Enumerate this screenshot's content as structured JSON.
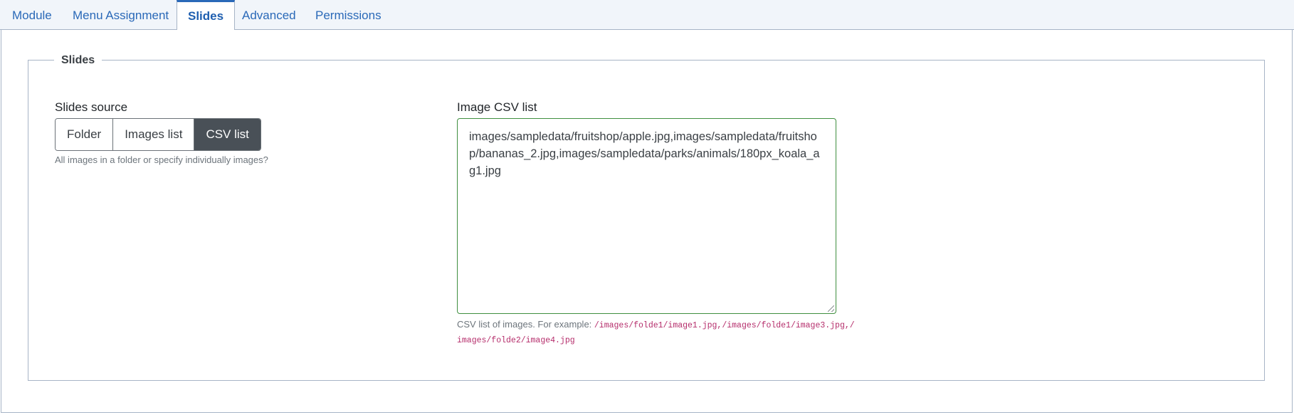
{
  "tabs": [
    {
      "label": "Module",
      "active": false
    },
    {
      "label": "Menu Assignment",
      "active": false
    },
    {
      "label": "Slides",
      "active": true
    },
    {
      "label": "Advanced",
      "active": false
    },
    {
      "label": "Permissions",
      "active": false
    }
  ],
  "fieldset": {
    "legend": "Slides"
  },
  "slides_source": {
    "label": "Slides source",
    "options": [
      "Folder",
      "Images list",
      "CSV list"
    ],
    "selected": "CSV list",
    "help": "All images in a folder or specify individually images?"
  },
  "csv_list": {
    "label": "Image CSV list",
    "value": "images/sampledata/fruitshop/apple.jpg,images/sampledata/fruitshop/bananas_2.jpg,images/sampledata/parks/animals/180px_koala_ag1.jpg",
    "help_prefix": "CSV list of images. For example: ",
    "help_example": "/images/folde1/image1.jpg,/images/folde1/image3.jpg,/images/folde2/image4.jpg"
  },
  "colors": {
    "accent": "#2a69b8",
    "active_button": "#495057",
    "valid_border": "#3f8f3f",
    "code": "#b52d6b"
  }
}
